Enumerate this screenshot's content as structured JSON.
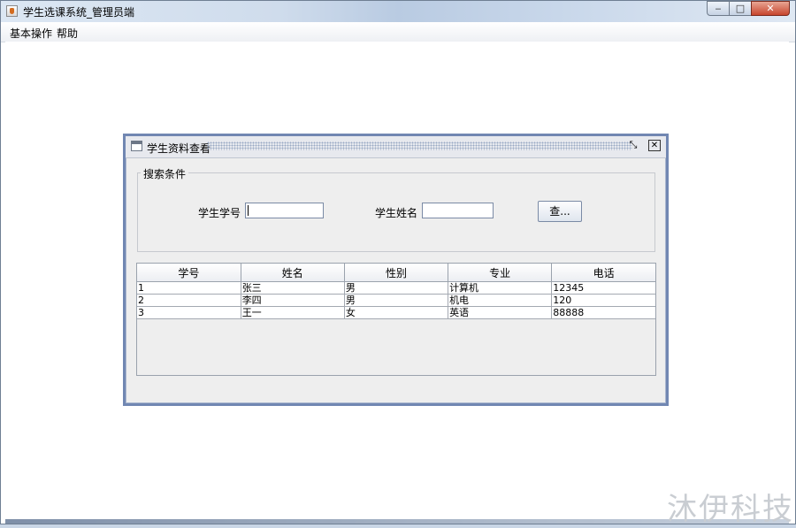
{
  "window": {
    "title": "学生选课系统_管理员端",
    "controls": {
      "minimize": "‒",
      "maximize": "□",
      "close": "✕"
    }
  },
  "menubar": {
    "items": [
      "基本操作",
      "帮助"
    ]
  },
  "internal_frame": {
    "title": "学生资料查看",
    "search": {
      "legend": "搜索条件",
      "student_id_label": "学生学号",
      "student_id_value": "",
      "student_name_label": "学生姓名",
      "student_name_value": "",
      "query_button": "查..."
    },
    "table": {
      "columns": [
        "学号",
        "姓名",
        "性别",
        "专业",
        "电话"
      ],
      "rows": [
        [
          "1",
          "张三",
          "男",
          "计算机",
          "12345"
        ],
        [
          "2",
          "李四",
          "男",
          "机电",
          "120"
        ],
        [
          "3",
          "王一",
          "女",
          "英语",
          "88888"
        ]
      ]
    }
  },
  "watermark": "沐伊科技"
}
